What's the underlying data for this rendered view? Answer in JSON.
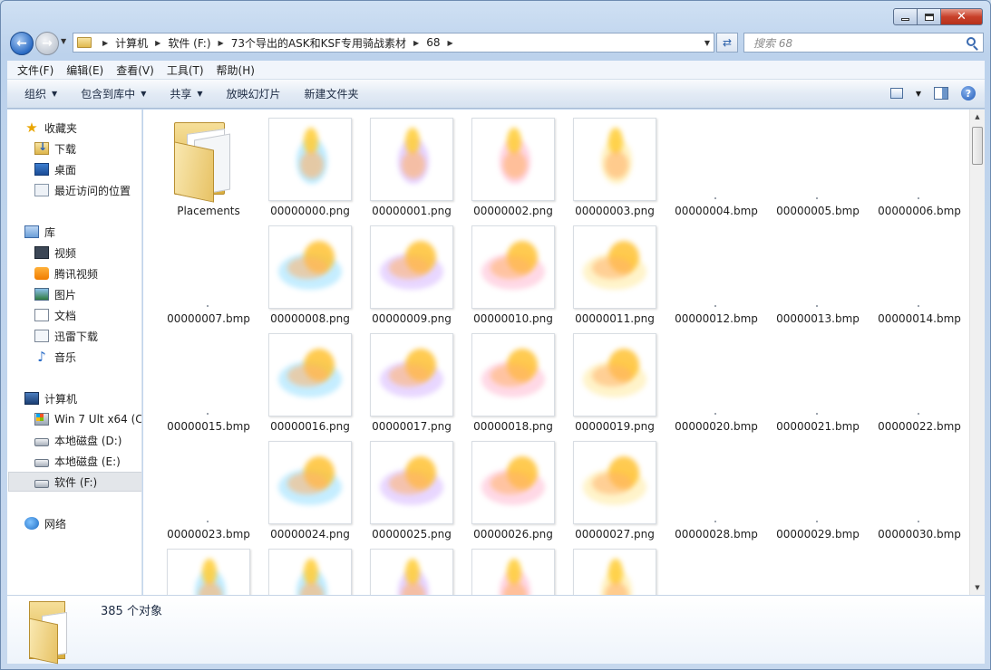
{
  "breadcrumbs": [
    "计算机",
    "软件 (F:)",
    "73个导出的ASK和KSF专用骑战素材",
    "68"
  ],
  "search": {
    "placeholder": "搜索 68"
  },
  "menu": [
    "文件(F)",
    "编辑(E)",
    "查看(V)",
    "工具(T)",
    "帮助(H)"
  ],
  "toolbar": {
    "organize": "组织",
    "include_library": "包含到库中",
    "share": "共享",
    "slideshow": "放映幻灯片",
    "new_folder": "新建文件夹"
  },
  "nav": {
    "favorites": {
      "label": "收藏夹",
      "items": [
        "下载",
        "桌面",
        "最近访问的位置"
      ]
    },
    "libraries": {
      "label": "库",
      "items": [
        "视频",
        "腾讯视频",
        "图片",
        "文档",
        "迅雷下载",
        "音乐"
      ]
    },
    "computer": {
      "label": "计算机",
      "items": [
        "Win 7 Ult x64 (C:",
        "本地磁盘 (D:)",
        "本地磁盘 (E:)",
        "软件 (F:)"
      ]
    },
    "network": {
      "label": "网络"
    }
  },
  "files": [
    "Placements",
    "00000000.png",
    "00000001.png",
    "00000002.png",
    "00000003.png",
    "00000004.bmp",
    "00000005.bmp",
    "00000006.bmp",
    "00000007.bmp",
    "00000008.png",
    "00000009.png",
    "00000010.png",
    "00000011.png",
    "00000012.bmp",
    "00000013.bmp",
    "00000014.bmp",
    "00000015.bmp",
    "00000016.png",
    "00000017.png",
    "00000018.png",
    "00000019.png",
    "00000020.bmp",
    "00000021.bmp",
    "00000022.bmp",
    "00000023.bmp",
    "00000024.png",
    "00000025.png",
    "00000026.png",
    "00000027.png",
    "00000028.bmp",
    "00000029.bmp",
    "00000030.bmp",
    "",
    "",
    "",
    "",
    ""
  ],
  "status": {
    "count_text": "385 个对象"
  },
  "colors": {
    "selection": "#e3e6ea",
    "accent": "#2a6bc4"
  }
}
